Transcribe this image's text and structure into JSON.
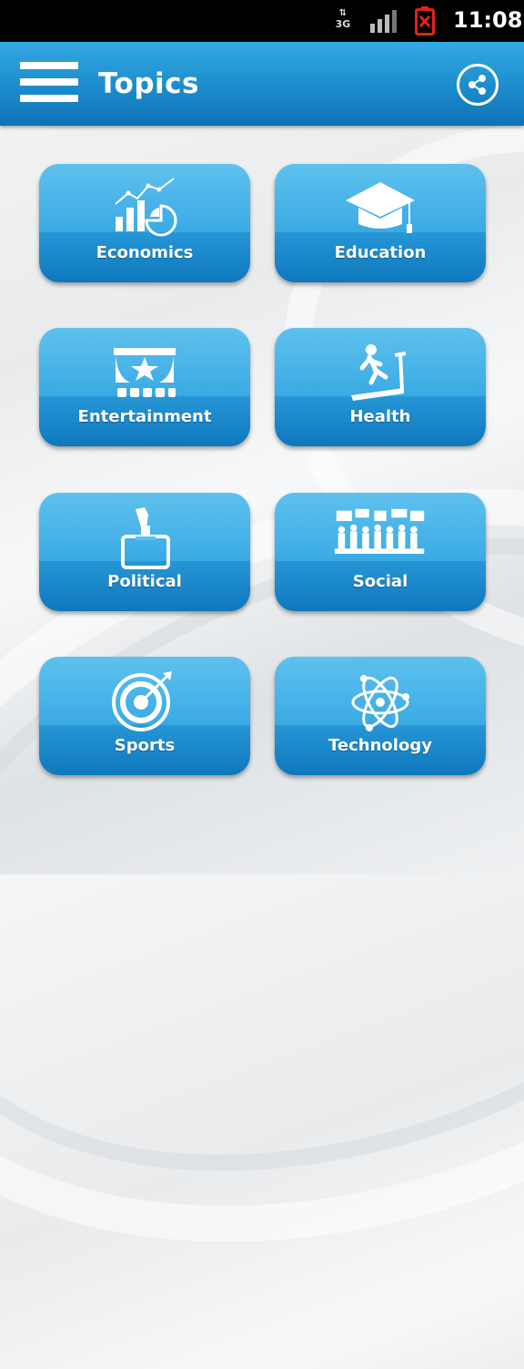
{
  "status_bar": {
    "network": "3G",
    "time": "11:08",
    "icons": [
      "data-arrows-icon",
      "signal-bars-icon",
      "battery-alert-icon"
    ]
  },
  "header": {
    "title": "Topics",
    "menu_icon": "hamburger-menu-icon",
    "share_icon": "share-icon"
  },
  "colors": {
    "header_blue": "#1b8ccc",
    "tile_light": "#5ec1ee",
    "tile_dark": "#0e78bd",
    "battery_alert": "#e2231a"
  },
  "topics": [
    {
      "label": "Economics",
      "icon": "chart-icon"
    },
    {
      "label": "Education",
      "icon": "graduation-cap-icon"
    },
    {
      "label": "Entertainment",
      "icon": "theater-icon"
    },
    {
      "label": "Health",
      "icon": "treadmill-icon"
    },
    {
      "label": "Political",
      "icon": "ballot-box-icon"
    },
    {
      "label": "Social",
      "icon": "crowd-icon"
    },
    {
      "label": "Sports",
      "icon": "target-icon"
    },
    {
      "label": "Technology",
      "icon": "atom-icon"
    }
  ]
}
